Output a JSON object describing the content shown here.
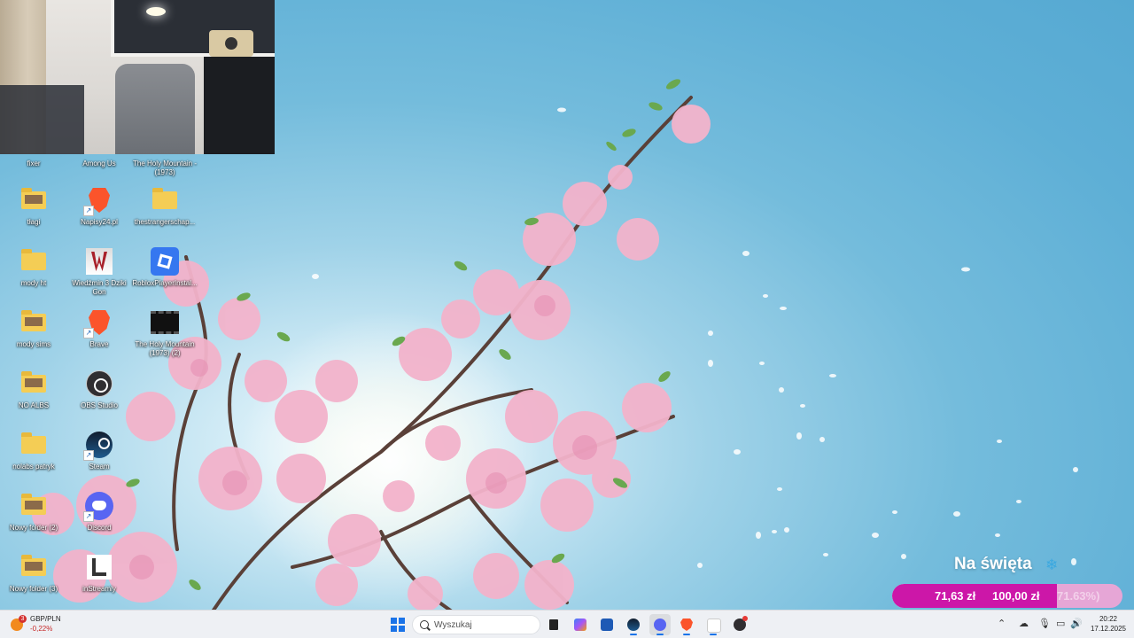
{
  "desktop": {
    "icons": [
      {
        "label": "fixer",
        "type": "folder"
      },
      {
        "label": "Among Us",
        "type": "app"
      },
      {
        "label": "The Holy Mountain - (1973)",
        "type": "video"
      },
      {
        "label": "tłagi",
        "type": "folder"
      },
      {
        "label": "Napisy24.pl",
        "type": "brave-shortcut"
      },
      {
        "label": "thestrangerschap...",
        "type": "folder"
      },
      {
        "label": "mody ht",
        "type": "folder"
      },
      {
        "label": "Wiedźmin 3 Dziki Gon",
        "type": "witcher"
      },
      {
        "label": "RobloxPlayerInstal...",
        "type": "roblox"
      },
      {
        "label": "mody sims",
        "type": "folder"
      },
      {
        "label": "Brave",
        "type": "brave"
      },
      {
        "label": "The Holy Mountain (1973) (2)",
        "type": "video"
      },
      {
        "label": "NO ALBS",
        "type": "folder"
      },
      {
        "label": "OBS Studio",
        "type": "obs"
      },
      {
        "label": "nolabs patryk",
        "type": "folder"
      },
      {
        "label": "Steam",
        "type": "steam"
      },
      {
        "label": "Nowy folder (2)",
        "type": "folder"
      },
      {
        "label": "Discord",
        "type": "discord"
      },
      {
        "label": "Nowy folder (3)",
        "type": "folder"
      },
      {
        "label": "inStreamly",
        "type": "instreamly"
      }
    ]
  },
  "goal": {
    "title": "Na święta",
    "current": "71,63 zł",
    "target": "100,00 zł",
    "percent_label": "71.63%)",
    "progress": 0.7163,
    "fill_color": "#cc17a8",
    "track_color": "#e6a6d6"
  },
  "taskbar": {
    "weather": {
      "badge": "3",
      "pair": "GBP/PLN",
      "change": "-0,22%"
    },
    "search_placeholder": "Wyszukaj",
    "apps": [
      "file-explorer",
      "copilot",
      "store",
      "steam",
      "discord",
      "brave",
      "instreamly",
      "obs"
    ],
    "clock": {
      "time": "20:22",
      "date": "17.12.2025"
    }
  }
}
